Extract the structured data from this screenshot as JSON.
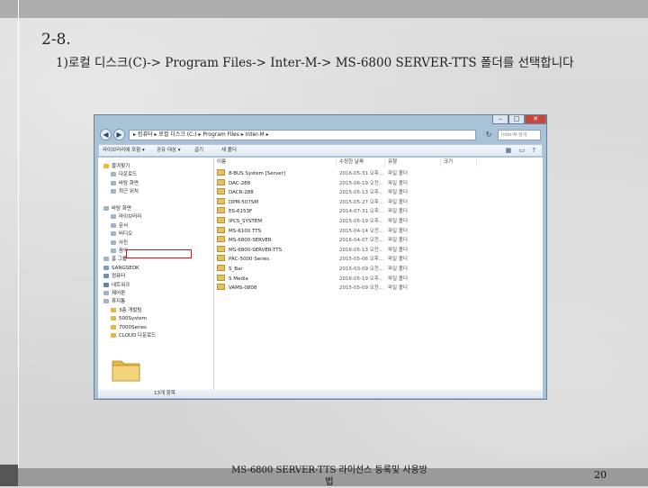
{
  "slide": {
    "title": "2-8.",
    "subtitle": "1)로컬 디스크(C)-> Program Files-> Inter-M-> MS-6800 SERVER-TTS 폴더를 선택합니다",
    "footer": "MS-6800 SERVER-TTS 라이선스 등록및 사용방법",
    "page_number": "20"
  },
  "explorer": {
    "address_path": "▸ 컴퓨터 ▸ 로컬 디스크 (C:) ▸ Program Files ▸ Inter-M ▸",
    "search_placeholder": "Inter-M 검색",
    "toolbar": [
      "라이브러리에 포함 ▾",
      "공유 대상 ▾",
      "굽기",
      "새 폴더"
    ],
    "columns": {
      "name": "이름",
      "date": "수정한 날짜",
      "type": "유형",
      "size": "크기"
    },
    "nav_items": [
      {
        "label": "즐겨찾기",
        "icon": "star-icon"
      },
      {
        "label": "다운로드",
        "icon": "download-icon"
      },
      {
        "label": "바탕 화면",
        "icon": "desktop-icon"
      },
      {
        "label": "최근 위치",
        "icon": "recent-icon"
      },
      {
        "label": "",
        "icon": ""
      },
      {
        "label": "바탕 화면",
        "icon": "desktop-icon"
      },
      {
        "label": "라이브러리",
        "icon": "library-icon"
      },
      {
        "label": "문서",
        "icon": "document-icon"
      },
      {
        "label": "비디오",
        "icon": "video-icon"
      },
      {
        "label": "사진",
        "icon": "picture-icon"
      },
      {
        "label": "음악",
        "icon": "music-icon"
      },
      {
        "label": "홈 그룹",
        "icon": "homegroup-icon"
      },
      {
        "label": "SANGSEOK",
        "icon": "user-icon"
      },
      {
        "label": "컴퓨터",
        "icon": "computer-icon"
      },
      {
        "label": "네트워크",
        "icon": "network-icon"
      },
      {
        "label": "제어판",
        "icon": "control-panel-icon"
      },
      {
        "label": "휴지통",
        "icon": "recycle-bin-icon"
      },
      {
        "label": "3층 개발팀",
        "icon": "folder-icon"
      },
      {
        "label": "500System",
        "icon": "folder-icon"
      },
      {
        "label": "7000Series",
        "icon": "folder-icon"
      },
      {
        "label": "CLOUD 다운로드",
        "icon": "folder-icon"
      }
    ],
    "files": [
      {
        "name": "8-BUS System [Server]",
        "date": "2016-05-31 오후...",
        "type": "파일 폴더"
      },
      {
        "name": "DAC-288",
        "date": "2015-06-19 오전...",
        "type": "파일 폴더"
      },
      {
        "name": "DACR-288",
        "date": "2015-05-13 오후...",
        "type": "파일 폴더"
      },
      {
        "name": "DPM-507SM",
        "date": "2015-05-27 오후...",
        "type": "파일 폴더"
      },
      {
        "name": "ES-6153F",
        "date": "2014-07-31 오후...",
        "type": "파일 폴더"
      },
      {
        "name": "IPCS_SYSTEM",
        "date": "2015-05-19 오후...",
        "type": "파일 폴더"
      },
      {
        "name": "MS-6100 TTS",
        "date": "2015-04-14 오전...",
        "type": "파일 폴더"
      },
      {
        "name": "MS-6800-SERVER",
        "date": "2016-04-07 오전...",
        "type": "파일 폴더"
      },
      {
        "name": "MS-6800-SERVER-TTS",
        "date": "2016-05-13 오전...",
        "type": "파일 폴더"
      },
      {
        "name": "PAC-5000 Series",
        "date": "2015-05-06 오후...",
        "type": "파일 폴더"
      },
      {
        "name": "S_Bar",
        "date": "2015-03-09 오전...",
        "type": "파일 폴더"
      },
      {
        "name": "S Media",
        "date": "2016-05-19 오후...",
        "type": "파일 폴더"
      },
      {
        "name": "VAMS-0808",
        "date": "2015-05-09 오전...",
        "type": "파일 폴더"
      }
    ],
    "status_text": "13개 항목",
    "selected_index": 8
  }
}
